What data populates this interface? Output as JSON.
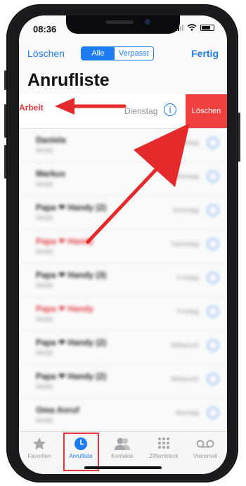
{
  "status": {
    "time": "08:36"
  },
  "nav": {
    "left_label": "Löschen",
    "right_label": "Fertig",
    "segments": [
      {
        "label": "Alle"
      },
      {
        "label": "Verpasst"
      }
    ]
  },
  "title": "Anrufliste",
  "swiped_row": {
    "action_label": "Arbeit",
    "date": "Dienstag",
    "info_glyph": "i",
    "delete_label": "Löschen"
  },
  "blurred_rows": [
    {
      "name": "Daniela",
      "sub": "Mobil",
      "date": "Dienstag",
      "missed": false
    },
    {
      "name": "Markus",
      "sub": "Mobil",
      "date": "Montag",
      "missed": false
    },
    {
      "name": "Papa ❤ Handy (2)",
      "sub": "Mobil",
      "date": "Sonntag",
      "missed": false
    },
    {
      "name": "Papa ❤ Handy",
      "sub": "Mobil",
      "date": "Samstag",
      "missed": true
    },
    {
      "name": "Papa ❤ Handy (3)",
      "sub": "Mobil",
      "date": "Freitag",
      "missed": false
    },
    {
      "name": "Papa ❤ Handy",
      "sub": "Mobil",
      "date": "Freitag",
      "missed": true
    },
    {
      "name": "Papa ❤ Handy (2)",
      "sub": "Mobil",
      "date": "Mittwoch",
      "missed": false
    },
    {
      "name": "Papa ❤ Handy (2)",
      "sub": "Mobil",
      "date": "Mittwoch",
      "missed": false
    },
    {
      "name": "Oma Anruf",
      "sub": "Mobil",
      "date": "Montag",
      "missed": false
    }
  ],
  "tabs": [
    {
      "label": "Favoriten",
      "icon": "star-icon"
    },
    {
      "label": "Anrufliste",
      "icon": "clock-icon",
      "active": true
    },
    {
      "label": "Kontakte",
      "icon": "contacts-icon"
    },
    {
      "label": "Ziffernblock",
      "icon": "keypad-icon"
    },
    {
      "label": "Voicemail",
      "icon": "voicemail-icon"
    }
  ],
  "colors": {
    "accent": "#1e7cf2",
    "delete_red": "#f0403f",
    "annotation_red": "#e0383c"
  }
}
